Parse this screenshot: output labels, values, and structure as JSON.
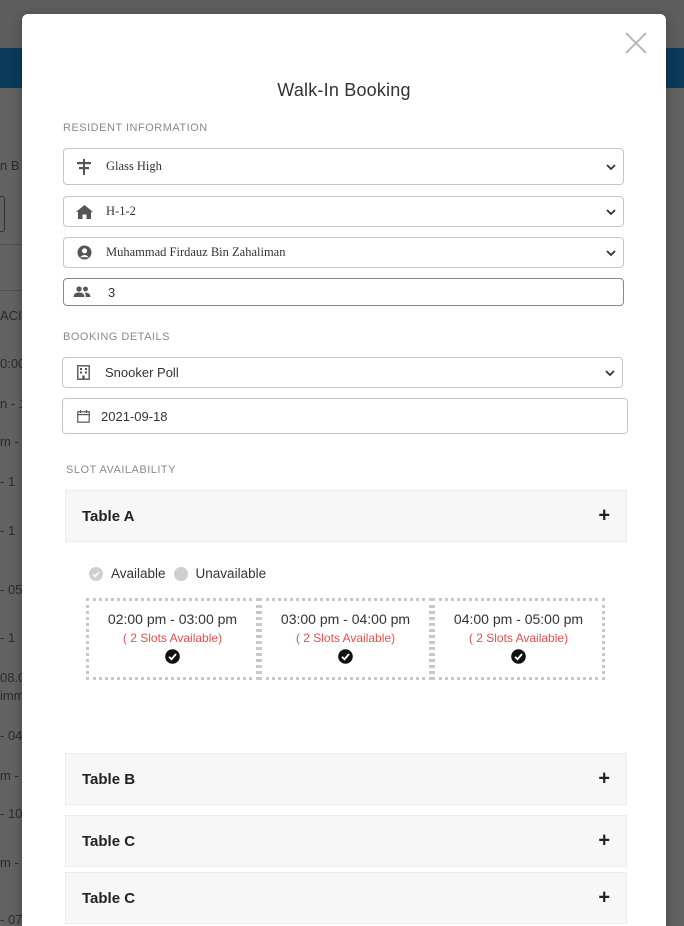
{
  "background": {
    "fragments": [
      "n B",
      "ACIL",
      "0:00",
      "n - 1",
      "m -",
      "- 1",
      "- 1",
      "- 05",
      "- 1",
      "08.0",
      "imm",
      "- 04",
      "m -",
      "- 10",
      "m -",
      "- 07"
    ]
  },
  "modal": {
    "title": "Walk-In Booking",
    "resident_section": "RESIDENT INFORMATION",
    "booking_section": "BOOKING DETAILS",
    "slot_section": "SLOT AVAILABILITY"
  },
  "fields": {
    "building": {
      "icon": "signpost-icon",
      "value": "Glass High"
    },
    "unit": {
      "icon": "home-icon",
      "value": "H-1-2"
    },
    "resident": {
      "icon": "user-circle-icon",
      "value": "Muhammad Firdauz Bin Zahaliman"
    },
    "guests": {
      "icon": "people-icon",
      "value": "3"
    },
    "facility": {
      "icon": "building-icon",
      "value": "Snooker Poll"
    },
    "date": {
      "icon": "calendar-icon",
      "value": "2021-09-18"
    }
  },
  "legend": {
    "available": "Available",
    "unavailable": "Unavailable"
  },
  "tables": [
    {
      "name": "Table A",
      "toggle": "+"
    },
    {
      "name": "Table B",
      "toggle": "+"
    },
    {
      "name": "Table C",
      "toggle": "+"
    },
    {
      "name": "Table C",
      "toggle": "+"
    }
  ],
  "slots": [
    {
      "time": "02:00 pm - 03:00 pm",
      "availability": "( 2 Slots Available)"
    },
    {
      "time": "03:00 pm - 04:00 pm",
      "availability": "( 2 Slots Available)"
    },
    {
      "time": "04:00 pm - 05:00 pm",
      "availability": "( 2 Slots Available)"
    }
  ],
  "colors": {
    "accent_red": "#d9534f",
    "header_blue": "#0a3a5a"
  }
}
